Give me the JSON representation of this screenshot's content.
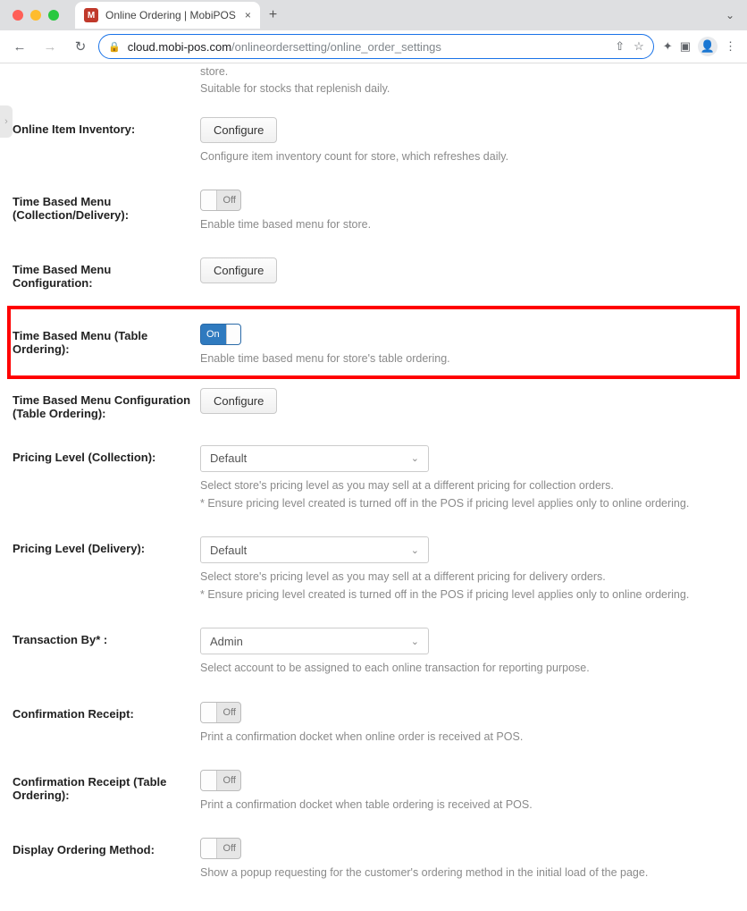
{
  "chrome": {
    "window_controls": {
      "close": "#ff5f57",
      "min": "#febc2e",
      "max": "#28c840"
    },
    "tab": {
      "favicon_letter": "M",
      "title": "Online Ordering | MobiPOS",
      "close": "×"
    },
    "new_tab": "+",
    "tabs_dropdown": "⌄",
    "nav": {
      "back": "←",
      "forward": "→",
      "reload": "↻"
    },
    "lock": "🔒",
    "url_host": "cloud.mobi-pos.com",
    "url_path": "/onlineordersetting/online_order_settings",
    "share": "⇧",
    "star": "☆",
    "ext": "✦",
    "panel": "▣",
    "avatar": "👤",
    "menu": "⋮",
    "handle": "›"
  },
  "prelude": {
    "line1": "store.",
    "line2": "Suitable for stocks that replenish daily."
  },
  "rows": {
    "inventory": {
      "label": "Online Item Inventory:",
      "button": "Configure",
      "help": "Configure item inventory count for store, which refreshes daily."
    },
    "tbm_cd": {
      "label": "Time Based Menu (Collection/Delivery):",
      "toggle": "Off",
      "help": "Enable time based menu for store."
    },
    "tbm_conf": {
      "label": "Time Based Menu Configuration:",
      "button": "Configure"
    },
    "tbm_table": {
      "label": "Time Based Menu (Table Ordering):",
      "toggle": "On",
      "help": "Enable time based menu for store's table ordering."
    },
    "tbm_table_conf": {
      "label": "Time Based Menu Configuration (Table Ordering):",
      "button": "Configure"
    },
    "pricing_collection": {
      "label": "Pricing Level (Collection):",
      "value": "Default",
      "help1": "Select store's pricing level as you may sell at a different pricing for collection orders.",
      "help2": "* Ensure pricing level created is turned off in the POS if pricing level applies only to online ordering."
    },
    "pricing_delivery": {
      "label": "Pricing Level (Delivery):",
      "value": "Default",
      "help1": "Select store's pricing level as you may sell at a different pricing for delivery orders.",
      "help2": "* Ensure pricing level created is turned off in the POS if pricing level applies only to online ordering."
    },
    "txn_by": {
      "label": "Transaction By* :",
      "value": "Admin",
      "help": "Select account to be assigned to each online transaction for reporting purpose."
    },
    "conf_receipt": {
      "label": "Confirmation Receipt:",
      "toggle": "Off",
      "help": "Print a confirmation docket when online order is received at POS."
    },
    "conf_receipt_table": {
      "label": "Confirmation Receipt (Table Ordering):",
      "toggle": "Off",
      "help": "Print a confirmation docket when table ordering is received at POS."
    },
    "display_method": {
      "label": "Display Ordering Method:",
      "toggle": "Off",
      "help": "Show a popup requesting for the customer's ordering method in the initial load of the page."
    }
  }
}
